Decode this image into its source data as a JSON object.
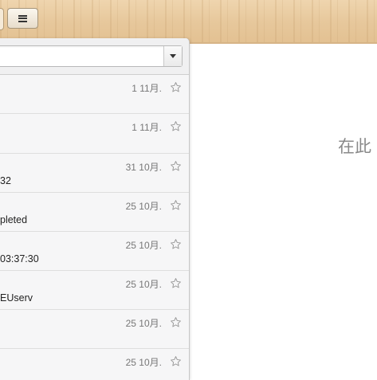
{
  "toolbar": {
    "menu_icon": "hamburger-icon"
  },
  "filter": {
    "selected": ""
  },
  "messages": [
    {
      "date": "1 11月.",
      "subject": "",
      "starred": false
    },
    {
      "date": "1 11月.",
      "subject": "",
      "starred": false
    },
    {
      "date": "31 10月.",
      "subject": "32",
      "starred": false
    },
    {
      "date": "25 10月.",
      "subject": "pleted",
      "starred": false
    },
    {
      "date": "25 10月.",
      "subject": "03:37:30",
      "starred": false
    },
    {
      "date": "25 10月.",
      "subject": "EUserv",
      "starred": false
    },
    {
      "date": "25 10月.",
      "subject": "",
      "starred": false
    },
    {
      "date": "25 10月.",
      "subject": "",
      "starred": false
    }
  ],
  "preview": {
    "placeholder": "在此"
  },
  "colors": {
    "wood": "#e9cba0",
    "panel_bg": "#f6f6f7",
    "date": "#777777",
    "star": "#9a9a9a"
  }
}
